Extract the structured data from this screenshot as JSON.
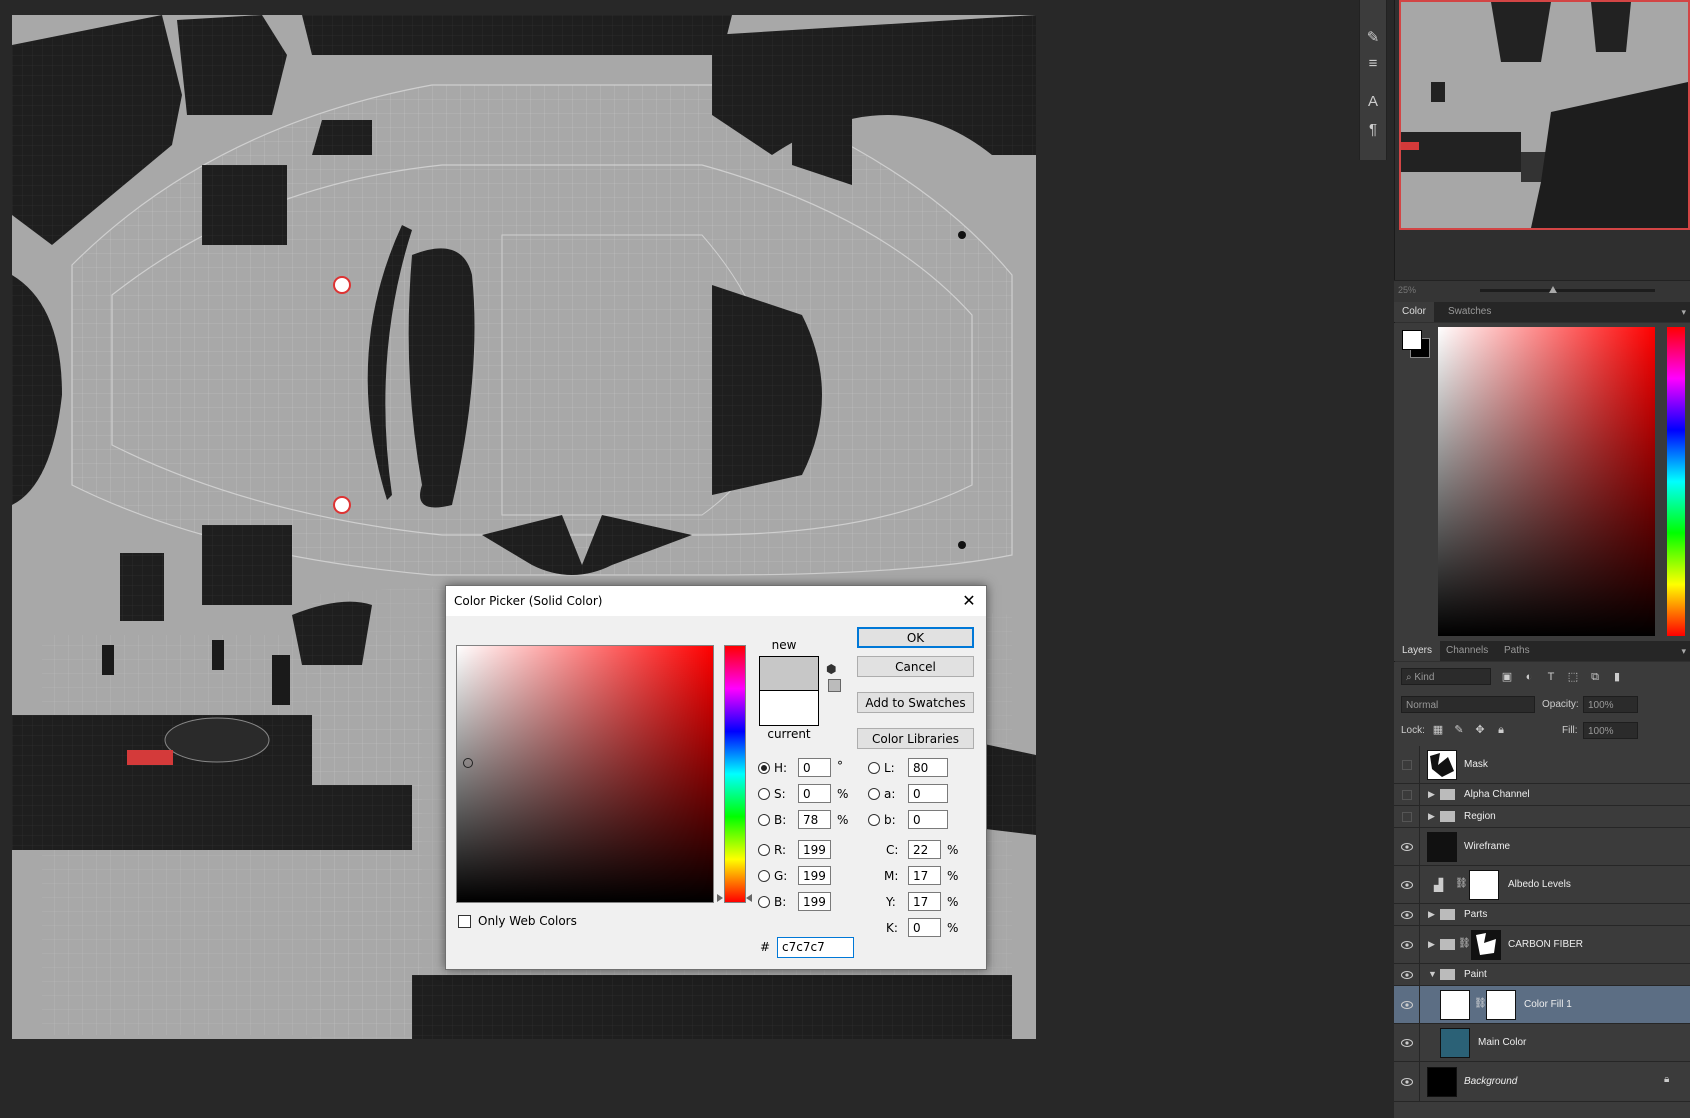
{
  "navigator": {
    "zoom": "25%"
  },
  "color_panel": {
    "tabs": [
      "Color",
      "Swatches"
    ],
    "foreground": "#ffffff",
    "background": "#000000"
  },
  "layers_panel": {
    "tabs": [
      "Layers",
      "Channels",
      "Paths"
    ],
    "filter_kind": "Kind",
    "blend_mode": "Normal",
    "opacity_label": "Opacity:",
    "opacity_value": "100%",
    "lock_label": "Lock:",
    "fill_label": "Fill:",
    "fill_value": "100%",
    "layers": [
      {
        "name": "Mask",
        "visible": false,
        "type": "raster"
      },
      {
        "name": "Alpha Channel",
        "visible": false,
        "type": "group"
      },
      {
        "name": "Region",
        "visible": false,
        "type": "group"
      },
      {
        "name": "Wireframe",
        "visible": true,
        "type": "raster"
      },
      {
        "name": "Albedo Levels",
        "visible": true,
        "type": "adjustment"
      },
      {
        "name": "Parts",
        "visible": true,
        "type": "group"
      },
      {
        "name": "CARBON FIBER",
        "visible": true,
        "type": "group-masked"
      },
      {
        "name": "Paint",
        "visible": true,
        "type": "group-open"
      },
      {
        "name": "Color Fill 1",
        "visible": true,
        "type": "fill",
        "selected": true
      },
      {
        "name": "Main Color",
        "visible": true,
        "type": "raster"
      },
      {
        "name": "Background",
        "visible": true,
        "type": "background",
        "locked": true
      }
    ]
  },
  "dialog": {
    "title": "Color Picker (Solid Color)",
    "buttons": {
      "ok": "OK",
      "cancel": "Cancel",
      "add_swatches": "Add to Swatches",
      "libraries": "Color Libraries"
    },
    "label_new": "new",
    "label_current": "current",
    "new_color": "#c7c7c7",
    "current_color": "#ffffff",
    "only_web_colors": "Only Web Colors",
    "fields": {
      "H": "0",
      "S": "0",
      "B": "78",
      "R": "199",
      "G": "199",
      "B2": "199",
      "L": "80",
      "a": "0",
      "b": "0",
      "C": "22",
      "M": "17",
      "Y": "17",
      "K": "0"
    },
    "labels": {
      "H": "H:",
      "S": "S:",
      "B": "B:",
      "R": "R:",
      "G": "G:",
      "B2": "B:",
      "L": "L:",
      "a": "a:",
      "b": "b:",
      "C": "C:",
      "M": "M:",
      "Y": "Y:",
      "K": "K:"
    },
    "units": {
      "deg": "°",
      "pct": "%"
    },
    "hex_label": "#",
    "hex_value": "c7c7c7"
  }
}
